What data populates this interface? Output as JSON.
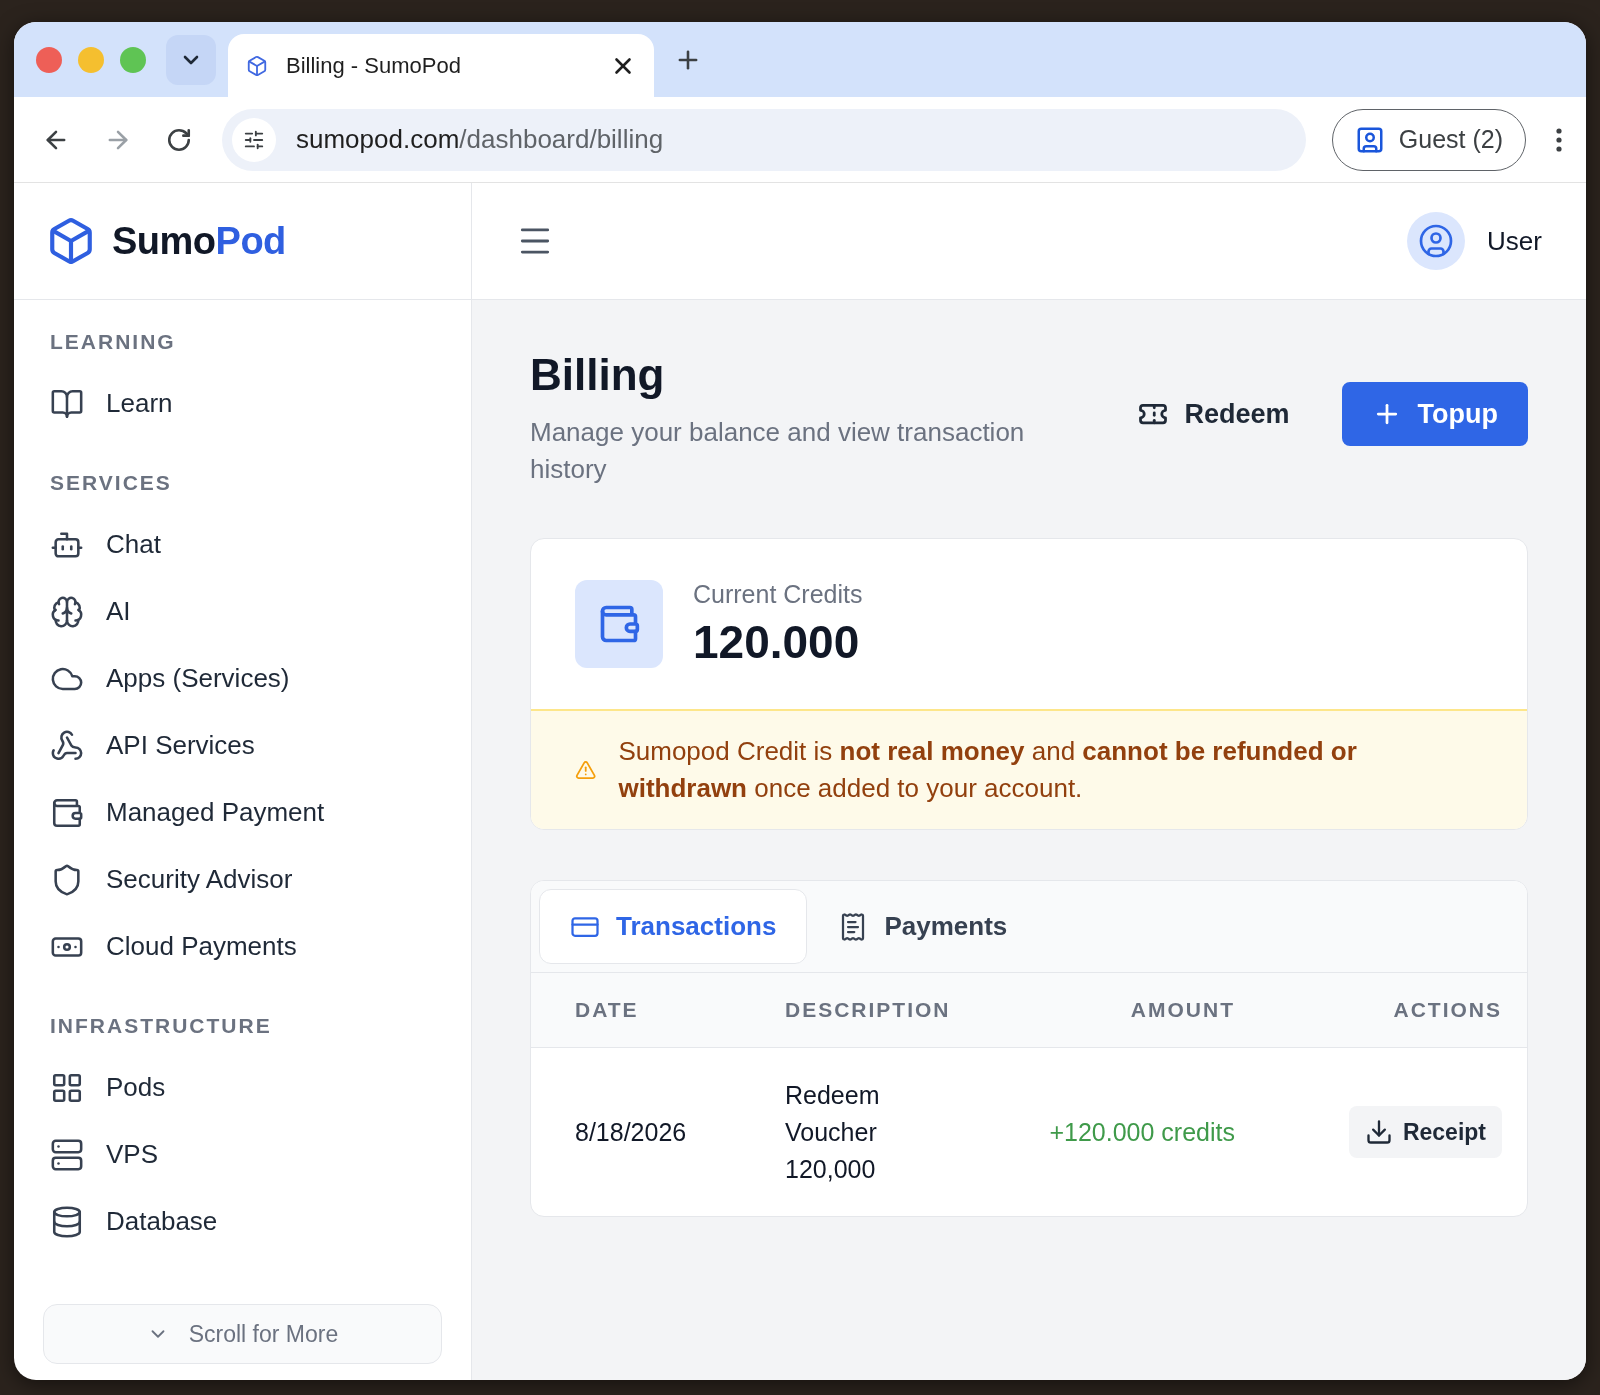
{
  "browser": {
    "tab_title": "Billing - SumoPod",
    "url_host": "sumopod.com",
    "url_path": "/dashboard/billing",
    "profile": "Guest (2)"
  },
  "brand": {
    "first": "Sumo",
    "second": "Pod"
  },
  "header": {
    "user": "User"
  },
  "sidebar": {
    "sections": [
      {
        "title": "LEARNING",
        "items": [
          "Learn"
        ]
      },
      {
        "title": "SERVICES",
        "items": [
          "Chat",
          "AI",
          "Apps (Services)",
          "API Services",
          "Managed Payment",
          "Security Advisor",
          "Cloud Payments"
        ]
      },
      {
        "title": "INFRASTRUCTURE",
        "items": [
          "Pods",
          "VPS",
          "Database"
        ]
      }
    ],
    "scroll_button": "Scroll for More"
  },
  "page": {
    "title": "Billing",
    "subtitle": "Manage your balance and view transaction history",
    "buttons": [
      {
        "label": "Redeem",
        "kind": "ghost"
      },
      {
        "label": "Topup",
        "kind": "primary"
      }
    ]
  },
  "credits": {
    "label": "Current Credits",
    "value": "120.000",
    "warning": "Sumopod Credit is **not real money** and **cannot be refunded or withdrawn** once added to your account."
  },
  "tabs": [
    {
      "label": "Transactions",
      "selected": true
    },
    {
      "label": "Payments",
      "selected": false
    }
  ],
  "table": {
    "columns": [
      "DATE",
      "DESCRIPTION",
      "AMOUNT",
      "ACTIONS"
    ],
    "rows": [
      {
        "date": "8/18/2026",
        "description": "Redeem Voucher 120,000",
        "amount": "+120.000 credits",
        "action": "Receipt"
      }
    ]
  }
}
